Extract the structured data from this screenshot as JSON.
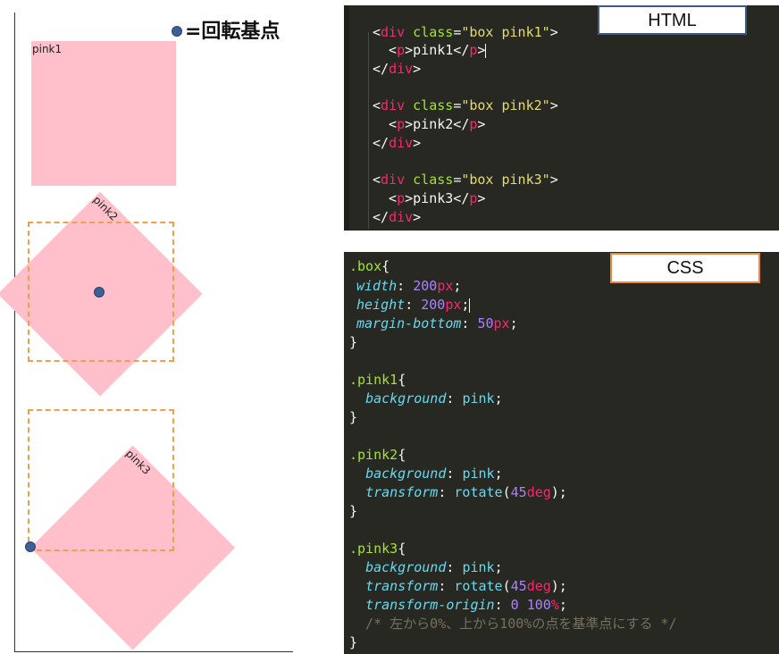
{
  "legend": {
    "text": "=回転基点"
  },
  "boxes": [
    {
      "label": "pink1"
    },
    {
      "label": "pink2"
    },
    {
      "label": "pink3"
    }
  ],
  "colors": {
    "pink": "#ffc0cb",
    "dot": "#3d5f96",
    "dashed": "#f0a04b",
    "editor_bg": "#272822"
  },
  "html_panel": {
    "label": "HTML",
    "lines": [
      "<div class=\"box pink1\">",
      "  <p>pink1</p>",
      "</div>",
      "",
      "<div class=\"box pink2\">",
      "  <p>pink2</p>",
      "</div>",
      "",
      "<div class=\"box pink3\">",
      "  <p>pink3</p>",
      "</div>"
    ]
  },
  "css_panel": {
    "label": "CSS",
    "lines": [
      ".box{",
      "width: 200px;",
      "height: 200px;",
      "margin-bottom: 50px;",
      "}",
      "",
      ".pink1{",
      "  background: pink;",
      "}",
      "",
      ".pink2{",
      "  background: pink;",
      "  transform: rotate(45deg);",
      "}",
      "",
      ".pink3{",
      "  background: pink;",
      "  transform: rotate(45deg);",
      "  transform-origin: 0 100%;",
      "  /* 左から0%、上から100%の点を基準点にする */",
      "}"
    ]
  }
}
